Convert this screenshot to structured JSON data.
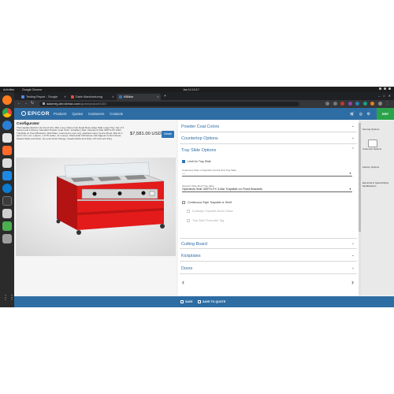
{
  "os": {
    "activities": "Activities",
    "app_name": "Google Chrome",
    "clock": "Jan 10  10:17"
  },
  "browser": {
    "tabs": [
      {
        "label": "Testing Report - Google",
        "fav_color": "#4c8bf5"
      },
      {
        "label": "Dake Manufacturing",
        "fav_color": "#e84b3c"
      },
      {
        "label": "KBMax",
        "fav_color": "#2e75b6"
      }
    ],
    "url_host": "dakemfg-dev.kbmax.com",
    "url_path": "/quote/product/1183"
  },
  "app": {
    "brand": "EPICOR",
    "nav": [
      "Products",
      "Quotes",
      "Customers",
      "Contacts"
    ],
    "badge": "ERP"
  },
  "product": {
    "title": "Configurator",
    "description": "Thermaplate Electric Hot Food Unit, 48in Long, Flame Grip Dead Body, Edge Wall, Hoga Tray, Set of 3 Sumps and a Rotary, Standard Powder Coat Color: Imbellerry Red, Operators Side 300TS-FX 3-Bar Trayslide on Fixed Brackets, Well Plate, customers's own only, stainless steel, Fence Sheet, Bull Hr 3 and 1 CO, Ltd, 1 plexin, 1 GTS sulfon, 11 4 amps, Shelf,shelf 4x8 Deluxe with Elgend Control Panel, Sealed Wells and Drain, No extra Drain Fittings, Sealed Wells and Drain, 6ft Cord and Plug",
    "price": "$7,581.00 USD",
    "details_label": "Details"
  },
  "options": {
    "sections_top": [
      "Powder Coat Colors",
      "Countertop Options",
      "Tray Slide Options"
    ],
    "tray": {
      "limit_label": "Limit for Tray Slide",
      "limit_checked": true,
      "field1_label": "Customers Side or Opposite Control Grid Tray Slide",
      "field1_value": "---",
      "field2_label": "Operator Side Shelf Tray Slide",
      "field2_value": "Operators Side 300TS-FX 3-Bar Trayslide on Fixed Brackets",
      "continuous_label": "Continuous Style Trayslide or Shelf",
      "continuous_checked": false,
      "sub1": "Is Always Trayslide Above Glass",
      "sub2": "Tray Slide Fixed with Tag"
    },
    "sections_bottom": [
      "Cutting Board",
      "Kickplates",
      "Doors"
    ],
    "prev": "‹",
    "next": "›"
  },
  "rail": {
    "items": [
      "Serving Options",
      "Customer Options",
      "Factory Options",
      "Electrical & Special Body Modifications"
    ]
  },
  "actions": {
    "save": "SAVE",
    "save_to_quote": "SAVE TO QUOTE"
  },
  "colors": {
    "brand_blue": "#2e6da4",
    "unit_red": "#e31b1b",
    "erp_green": "#2aa34a"
  }
}
